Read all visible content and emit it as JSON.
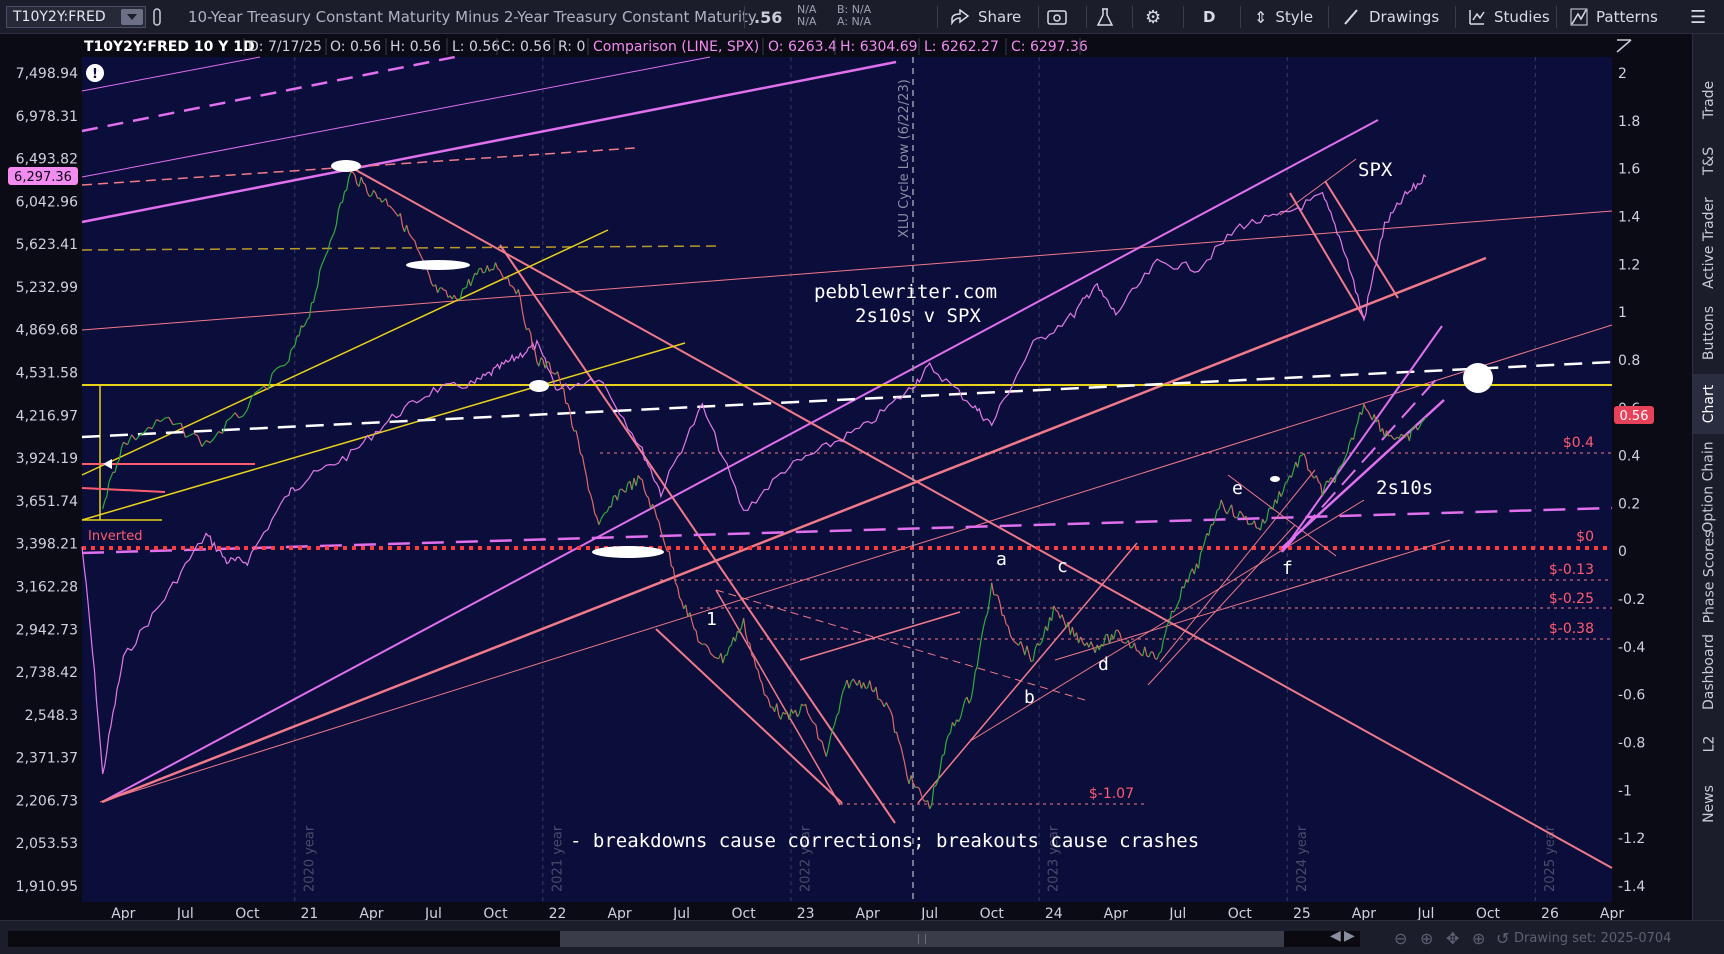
{
  "toolbar": {
    "symbol": "T10Y2Y:FRED",
    "description": "10-Year Treasury Constant Maturity Minus 2-Year Treasury Constant Maturity",
    "last": ".56",
    "na1": "N/A",
    "na2": "N/A",
    "bid": "B: N/A",
    "ask": "A: N/A",
    "share": "Share",
    "period": "D",
    "style": "Style",
    "drawings": "Drawings",
    "studies": "Studies",
    "patterns": "Patterns"
  },
  "header": {
    "symbol": "T10Y2Y:FRED 10 Y 1D",
    "date": "D: 7/17/25",
    "open": "O: 0.56",
    "high": "H: 0.56",
    "low": "L: 0.56",
    "close": "C: 0.56",
    "r": "R: 0",
    "comparison": "Comparison (LINE, SPX)",
    "c_open": "O: 6263.4",
    "c_high": "H: 6304.69",
    "c_low": "L: 6262.27",
    "c_close": "C: 6297.36"
  },
  "left_axis": {
    "ticks": [
      "7,498.94",
      "6,978.31",
      "6,493.82",
      "6,042.96",
      "5,623.41",
      "5,232.99",
      "4,869.68",
      "4,531.58",
      "4,216.97",
      "3,924.19",
      "3,651.74",
      "3,398.21",
      "3,162.28",
      "2,942.73",
      "2,738.42",
      "2,548.3",
      "2,371.37",
      "2,206.73",
      "2,053.53",
      "1,910.95"
    ],
    "current_label": "6,297.36"
  },
  "right_axis": {
    "ticks": [
      "2",
      "1.8",
      "1.6",
      "1.4",
      "1.2",
      "1",
      "0.8",
      "0.6",
      "0.4",
      "0.2",
      "0",
      "-0.2",
      "-0.4",
      "-0.6",
      "-0.8",
      "-1",
      "-1.2",
      "-1.4"
    ],
    "current_label": "0.56"
  },
  "x_axis": {
    "ticks": [
      "Apr",
      "Jul",
      "Oct",
      "21",
      "Apr",
      "Jul",
      "Oct",
      "22",
      "Apr",
      "Jul",
      "Oct",
      "23",
      "Apr",
      "Jul",
      "Oct",
      "24",
      "Apr",
      "Jul",
      "Oct",
      "25",
      "Apr",
      "Jul",
      "Oct",
      "26",
      "Apr"
    ],
    "year_labels": [
      "2020 year",
      "2021 year",
      "2022 year",
      "2023 year",
      "2024 year",
      "2025 year"
    ]
  },
  "annotations": {
    "site": "pebblewriter.com",
    "subtitle": "2s10s v SPX",
    "spx": "SPX",
    "s2s10s": "2s10s",
    "inverted": "Inverted",
    "cycle": "XLU Cycle Low (6/22/23)",
    "caption": "- breakdowns cause corrections; breakouts cause crashes",
    "wave_1": "1",
    "wave_a": "a",
    "wave_b": "b",
    "wave_c": "c",
    "wave_d": "d",
    "wave_e": "e",
    "wave_f": "f",
    "level_04": "$0.4",
    "level_0": "$0",
    "level_m013": "$-0.13",
    "level_m025": "$-0.25",
    "level_m038": "$-0.38",
    "level_m107": "$-1.07"
  },
  "side_tabs": [
    "Trade",
    "T&S",
    "Active Trader",
    "Buttons",
    "Chart",
    "Option Chain",
    "Phase Scores",
    "Dashboard",
    "L2",
    "News"
  ],
  "bottom": {
    "drawing_set": "Drawing set: 2025-0704"
  },
  "colors": {
    "background": "#0b0d3a",
    "spx_line": "#e27ae8",
    "t2s10s_up": "#2fae3a",
    "t2s10s_down": "#e06a6a",
    "trend_salmon": "#f07a8a",
    "trend_magenta": "#e070ee",
    "yellow": "#e8d21a",
    "red_dotted": "#ff3b3b",
    "white_dashed": "#ffffff"
  },
  "chart_data": {
    "type": "line",
    "x_range": [
      "2020-02",
      "2026-04"
    ],
    "series": [
      {
        "name": "T10Y2Y:FRED",
        "axis": "right",
        "points": [
          [
            "2020-03",
            0.2
          ],
          [
            "2020-04",
            0.45
          ],
          [
            "2020-06",
            0.55
          ],
          [
            "2020-08",
            0.45
          ],
          [
            "2020-10",
            0.6
          ],
          [
            "2020-12",
            0.8
          ],
          [
            "2021-01",
            1.0
          ],
          [
            "2021-02",
            1.3
          ],
          [
            "2021-03",
            1.58
          ],
          [
            "2021-04",
            1.5
          ],
          [
            "2021-05",
            1.45
          ],
          [
            "2021-06",
            1.3
          ],
          [
            "2021-07",
            1.1
          ],
          [
            "2021-08",
            1.05
          ],
          [
            "2021-09",
            1.15
          ],
          [
            "2021-10",
            1.2
          ],
          [
            "2021-11",
            1.1
          ],
          [
            "2021-12",
            0.8
          ],
          [
            "2022-01",
            0.75
          ],
          [
            "2022-02",
            0.45
          ],
          [
            "2022-03",
            0.1
          ],
          [
            "2022-04",
            0.25
          ],
          [
            "2022-05",
            0.3
          ],
          [
            "2022-06",
            0.1
          ],
          [
            "2022-07",
            -0.2
          ],
          [
            "2022-08",
            -0.4
          ],
          [
            "2022-09",
            -0.45
          ],
          [
            "2022-10",
            -0.3
          ],
          [
            "2022-11",
            -0.6
          ],
          [
            "2022-12",
            -0.7
          ],
          [
            "2023-01",
            -0.65
          ],
          [
            "2023-02",
            -0.85
          ],
          [
            "2023-03",
            -0.55
          ],
          [
            "2023-04",
            -0.55
          ],
          [
            "2023-05",
            -0.65
          ],
          [
            "2023-06",
            -0.95
          ],
          [
            "2023-07",
            -1.07
          ],
          [
            "2023-08",
            -0.75
          ],
          [
            "2023-09",
            -0.6
          ],
          [
            "2023-10",
            -0.15
          ],
          [
            "2023-11",
            -0.35
          ],
          [
            "2023-12",
            -0.45
          ],
          [
            "2024-01",
            -0.25
          ],
          [
            "2024-02",
            -0.35
          ],
          [
            "2024-03",
            -0.4
          ],
          [
            "2024-04",
            -0.35
          ],
          [
            "2024-05",
            -0.4
          ],
          [
            "2024-06",
            -0.45
          ],
          [
            "2024-07",
            -0.2
          ],
          [
            "2024-08",
            -0.05
          ],
          [
            "2024-09",
            0.2
          ],
          [
            "2024-10",
            0.15
          ],
          [
            "2024-11",
            0.1
          ],
          [
            "2024-12",
            0.25
          ],
          [
            "2025-01",
            0.4
          ],
          [
            "2025-02",
            0.25
          ],
          [
            "2025-03",
            0.35
          ],
          [
            "2025-04",
            0.62
          ],
          [
            "2025-05",
            0.5
          ],
          [
            "2025-06",
            0.46
          ],
          [
            "2025-07",
            0.56
          ]
        ]
      },
      {
        "name": "SPX",
        "axis": "left",
        "points": [
          [
            "2020-02",
            3380
          ],
          [
            "2020-03",
            2300
          ],
          [
            "2020-04",
            2800
          ],
          [
            "2020-06",
            3100
          ],
          [
            "2020-08",
            3450
          ],
          [
            "2020-09",
            3300
          ],
          [
            "2020-10",
            3300
          ],
          [
            "2020-12",
            3700
          ],
          [
            "2021-01",
            3800
          ],
          [
            "2021-03",
            3950
          ],
          [
            "2021-05",
            4200
          ],
          [
            "2021-07",
            4400
          ],
          [
            "2021-09",
            4450
          ],
          [
            "2021-10",
            4550
          ],
          [
            "2021-11",
            4650
          ],
          [
            "2021-12",
            4750
          ],
          [
            "2022-01",
            4400
          ],
          [
            "2022-03",
            4500
          ],
          [
            "2022-05",
            4000
          ],
          [
            "2022-06",
            3700
          ],
          [
            "2022-08",
            4280
          ],
          [
            "2022-10",
            3580
          ],
          [
            "2022-12",
            3850
          ],
          [
            "2023-02",
            4000
          ],
          [
            "2023-04",
            4150
          ],
          [
            "2023-06",
            4400
          ],
          [
            "2023-07",
            4580
          ],
          [
            "2023-09",
            4300
          ],
          [
            "2023-10",
            4150
          ],
          [
            "2023-12",
            4750
          ],
          [
            "2024-02",
            5000
          ],
          [
            "2024-03",
            5250
          ],
          [
            "2024-04",
            5000
          ],
          [
            "2024-06",
            5450
          ],
          [
            "2024-08",
            5400
          ],
          [
            "2024-10",
            5800
          ],
          [
            "2024-12",
            5900
          ],
          [
            "2025-02",
            6100
          ],
          [
            "2025-03",
            5600
          ],
          [
            "2025-04",
            4950
          ],
          [
            "2025-05",
            5800
          ],
          [
            "2025-06",
            6100
          ],
          [
            "2025-07",
            6297.36
          ]
        ]
      }
    ],
    "left_ylim": [
      1910.95,
      7498.94
    ],
    "right_ylim": [
      -1.4,
      2
    ],
    "log_scale_left": true,
    "grid": true
  }
}
